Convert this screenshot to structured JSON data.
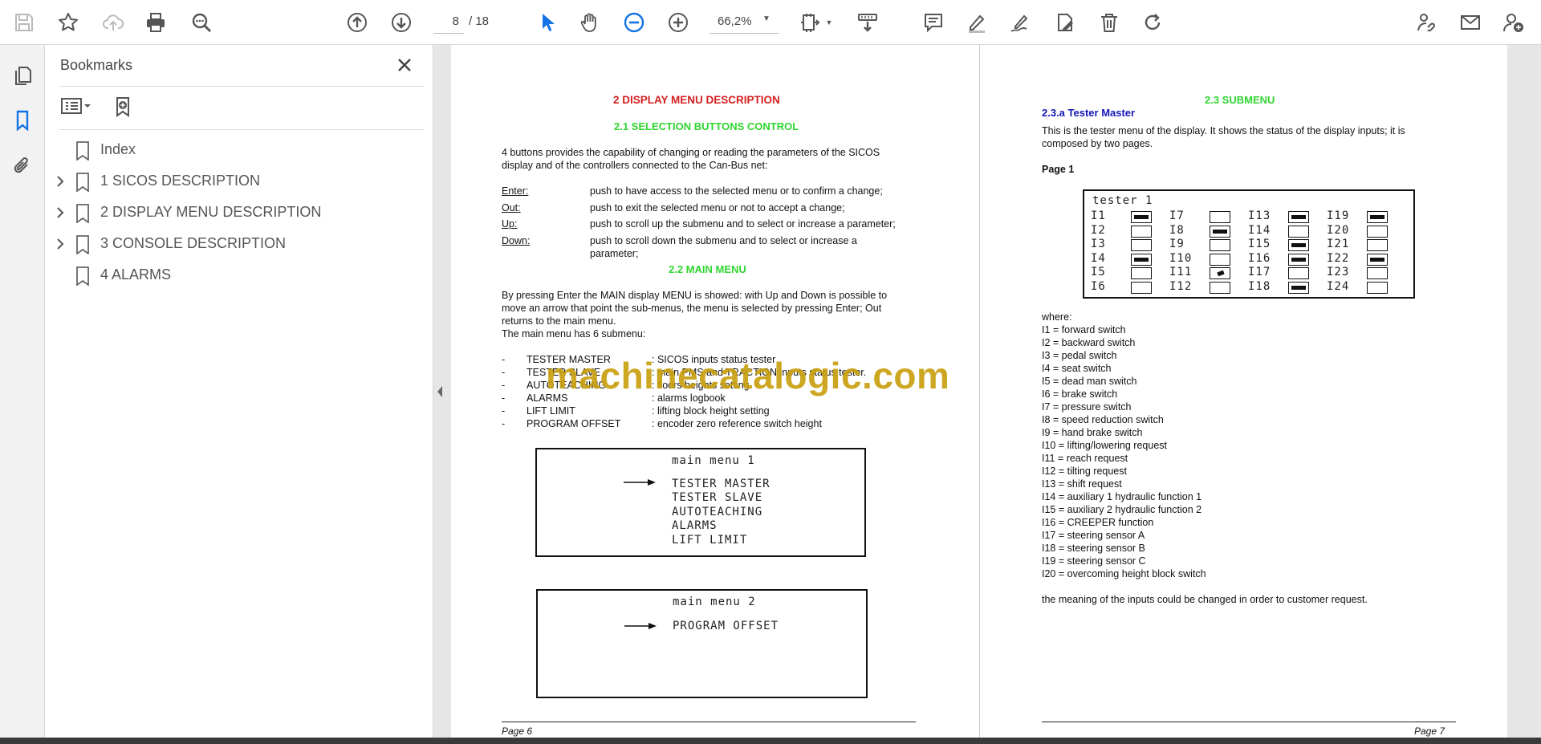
{
  "toolbar": {
    "page_current": "8",
    "page_sep": "/ 18",
    "zoom": "66,2%"
  },
  "panel": {
    "title": "Bookmarks",
    "bookmarks": [
      {
        "label": "Index",
        "expandable": false
      },
      {
        "label": "1 SICOS DESCRIPTION",
        "expandable": true
      },
      {
        "label": "2 DISPLAY MENU DESCRIPTION",
        "expandable": true
      },
      {
        "label": "3 CONSOLE DESCRIPTION",
        "expandable": true
      },
      {
        "label": "4 ALARMS",
        "expandable": false
      }
    ]
  },
  "page6": {
    "title": "2 DISPLAY MENU DESCRIPTION",
    "s21": "2.1 SELECTION BUTTONS CONTROL",
    "intro1": "4 buttons provides the capability of changing or reading the parameters of the SICOS",
    "intro2": "display and of the controllers connected to the Can-Bus net:",
    "buttons": [
      {
        "key": "Enter:",
        "desc": "push to have access to the selected menu or to confirm a change;"
      },
      {
        "key": "Out:",
        "desc": "push to exit the selected menu or not to accept a change;"
      },
      {
        "key": "Up:",
        "desc": "push to scroll up the submenu and to select or increase a parameter;"
      },
      {
        "key": "Down:",
        "desc": "push to scroll down the submenu and to select or increase a"
      }
    ],
    "down_cont": "parameter;",
    "s22": "2.2 MAIN MENU",
    "p1a": "By pressing Enter the MAIN display MENU is showed: with Up and Down is possible to",
    "p1b": "move an arrow that point the sub-menus, the menu is selected by pressing Enter; Out",
    "p1c": "returns to the main menu.",
    "p1d": "The main menu has 6 submenu:",
    "submenus": [
      {
        "dash": "-",
        "name": "TESTER MASTER",
        "desc": ": SICOS inputs status tester"
      },
      {
        "dash": "-",
        "name": "TESTER SLAVE",
        "desc": ": main PMS and TRACTION inputs status tester."
      },
      {
        "dash": "-",
        "name": "AUTOTEACHING",
        "desc": ": floors heights setting"
      },
      {
        "dash": "-",
        "name": "ALARMS",
        "desc": ": alarms logbook"
      },
      {
        "dash": "-",
        "name": "LIFT LIMIT",
        "desc": ": lifting block height setting"
      },
      {
        "dash": "-",
        "name": "PROGRAM OFFSET",
        "desc": ": encoder zero reference switch height"
      }
    ],
    "menu1_title": "main menu 1",
    "menu1_items": [
      "TESTER MASTER",
      "TESTER SLAVE",
      "AUTOTEACHING",
      "ALARMS",
      "LIFT LIMIT"
    ],
    "menu2_title": "main menu 2",
    "menu2_items": [
      "PROGRAM OFFSET"
    ],
    "footer": "Page 6"
  },
  "page7": {
    "s23": "2.3 SUBMENU",
    "s23a": "2.3.a Tester Master",
    "intro1": "This is the tester menu of the display. It shows the status of the display inputs; it is",
    "intro2": "composed by two pages.",
    "page_label": "Page 1",
    "tester_title": "tester 1",
    "tester_cols": [
      {
        "labels": [
          "I1",
          "I2",
          "I3",
          "I4",
          "I5",
          "I6"
        ],
        "states": [
          "on",
          "off",
          "off",
          "on",
          "off",
          "off"
        ]
      },
      {
        "labels": [
          "I7",
          "I8",
          "I9",
          "I10",
          "I11",
          "I12"
        ],
        "states": [
          "off",
          "on",
          "off",
          "off",
          "part",
          "off"
        ]
      },
      {
        "labels": [
          "I13",
          "I14",
          "I15",
          "I16",
          "I17",
          "I18"
        ],
        "states": [
          "on",
          "off",
          "on",
          "on",
          "off",
          "on"
        ]
      },
      {
        "labels": [
          "I19",
          "I20",
          "I21",
          "I22",
          "I23",
          "I24"
        ],
        "states": [
          "on",
          "off",
          "off",
          "on",
          "off",
          "off"
        ]
      }
    ],
    "where": "where:",
    "inputs": [
      "I1  = forward switch",
      "I2  = backward switch",
      "I3  = pedal switch",
      "I4  = seat switch",
      "I5  = dead man switch",
      "I6  = brake switch",
      "I7  = pressure switch",
      "I8  = speed reduction switch",
      "I9  = hand brake switch",
      "I10 = lifting/lowering request",
      "I11 = reach request",
      "I12 = tilting request",
      "I13 = shift request",
      "I14 = auxiliary 1 hydraulic function 1",
      "I15 = auxiliary 2 hydraulic function 2",
      "I16 = CREEPER function",
      "I17 = steering sensor A",
      "I18 = steering sensor B",
      "I19 = steering sensor C",
      "I20 = overcoming height block switch"
    ],
    "note": "the meaning of the inputs could be changed in order to customer request.",
    "footer": "Page 7"
  },
  "watermark": "machinecatalogic.com"
}
